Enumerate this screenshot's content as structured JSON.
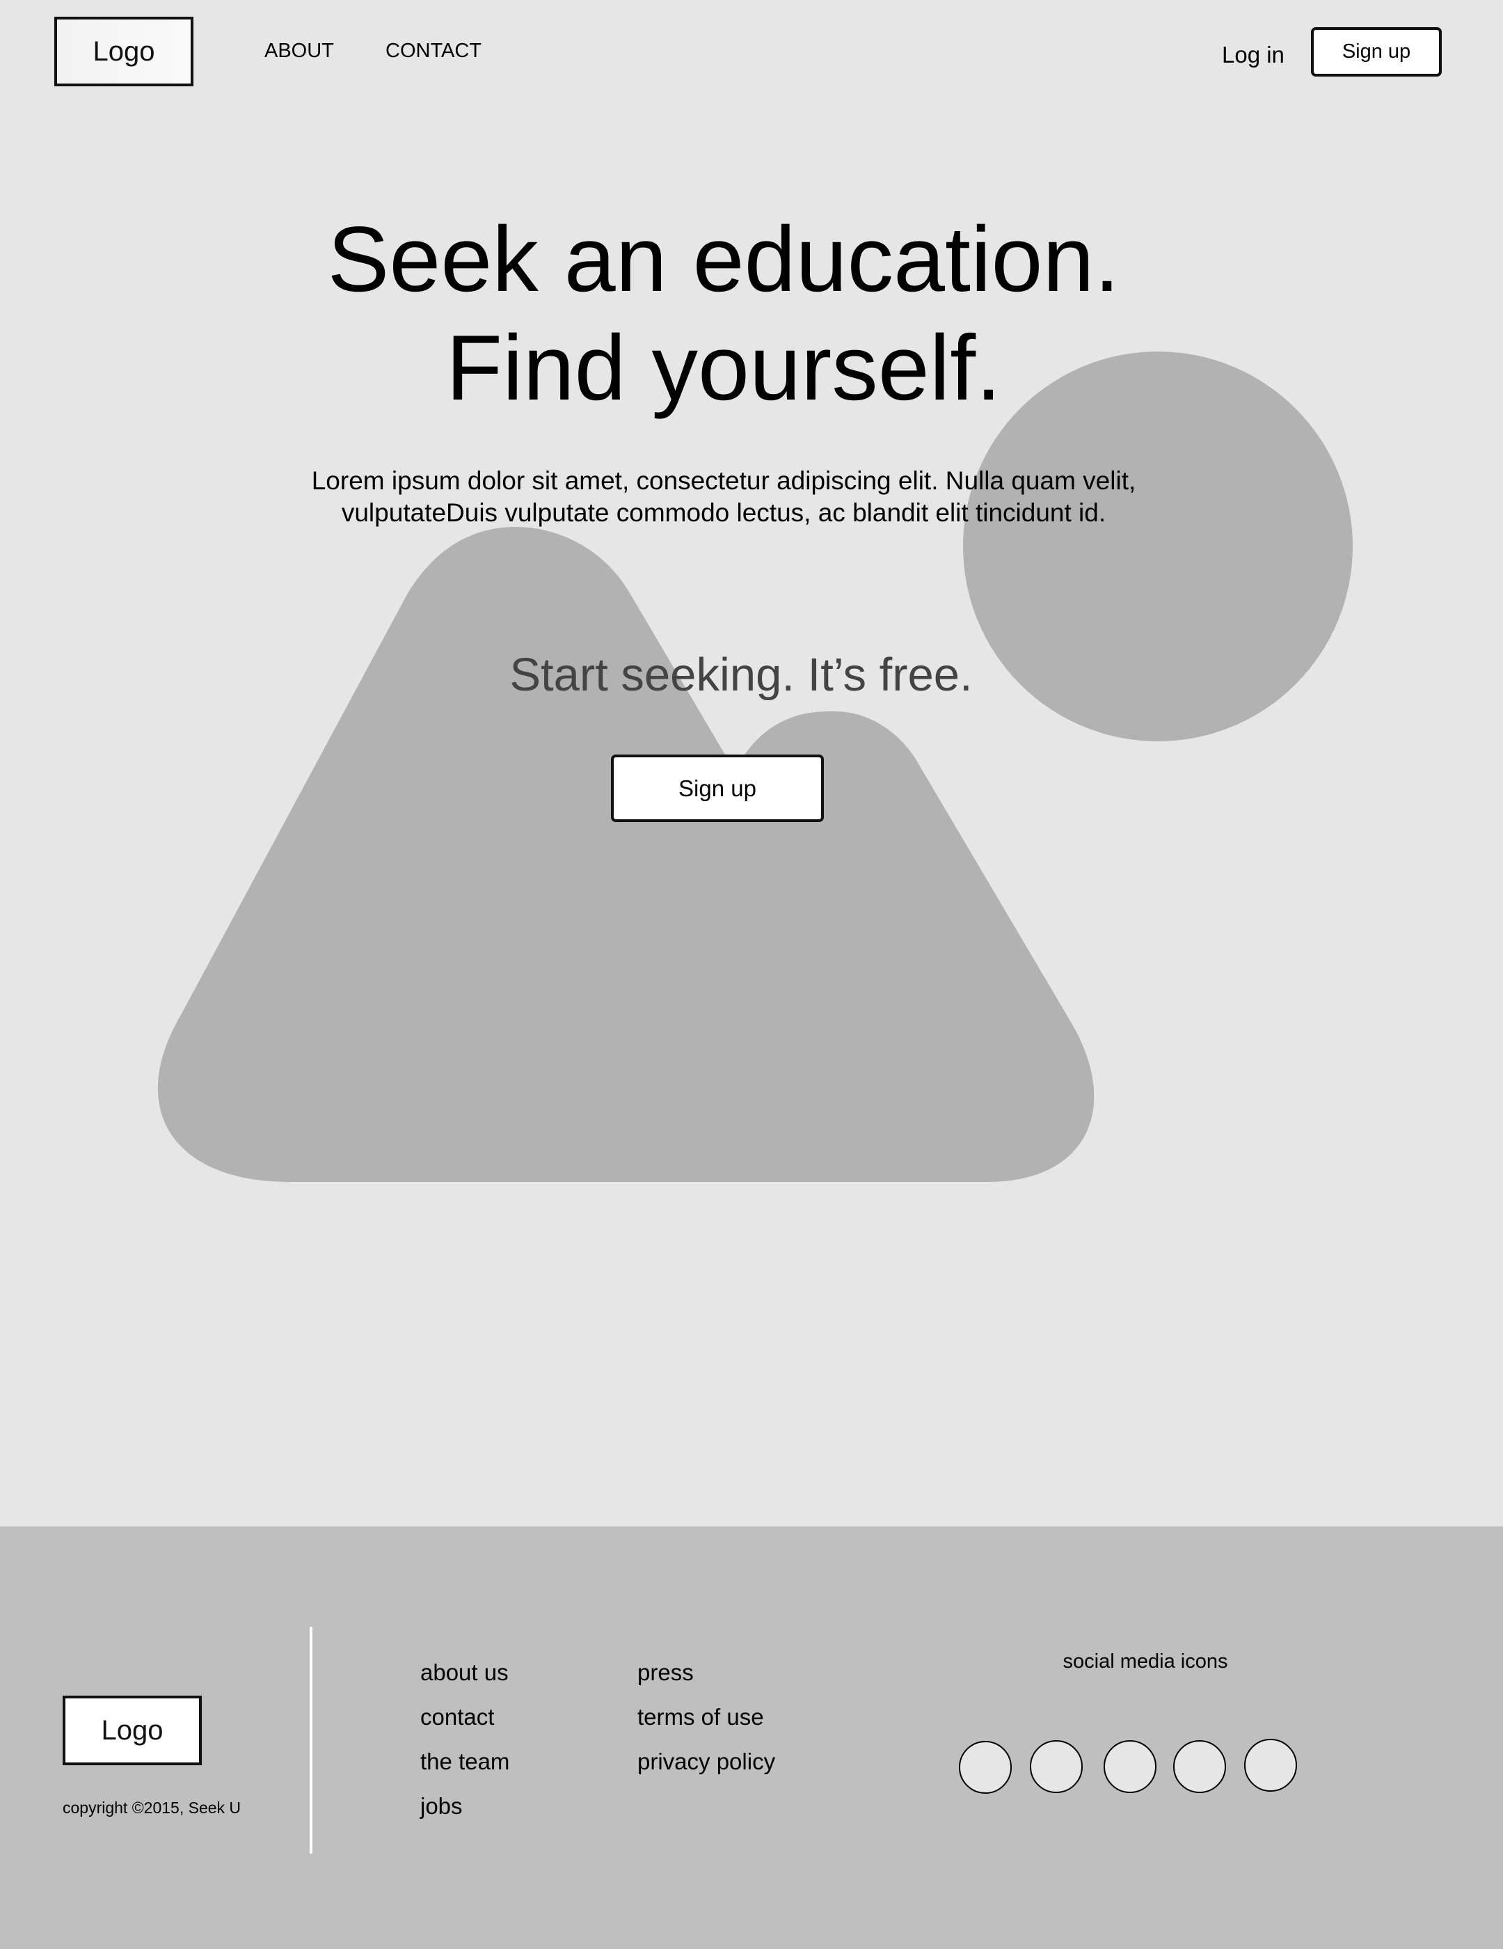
{
  "header": {
    "logo": "Logo",
    "nav": [
      {
        "label": "ABOUT"
      },
      {
        "label": "CONTACT"
      }
    ],
    "login_label": "Log in",
    "signup_label": "Sign up"
  },
  "hero": {
    "headline_line1": "Seek an education.",
    "headline_line2": "Find yourself.",
    "body_line1": "Lorem ipsum dolor sit amet, consectetur adipiscing elit. Nulla quam velit,",
    "body_line2": "vulputateDuis vulputate commodo lectus, ac blandit elit tincidunt id.",
    "cta_heading": "Start seeking. It’s free.",
    "cta_button": "Sign up"
  },
  "footer": {
    "logo": "Logo",
    "copyright": "copyright ©2015, Seek U",
    "links_col1": [
      "about us",
      "contact",
      "the team",
      "jobs"
    ],
    "links_col2": [
      "press",
      "terms of use",
      "privacy policy"
    ],
    "social_label": "social media icons",
    "social_icons": [
      "social-icon-1",
      "social-icon-2",
      "social-icon-3",
      "social-icon-4",
      "social-icon-5"
    ]
  },
  "colors": {
    "page_background": "#e6e6e6",
    "footer_background": "#bfbfbf",
    "placeholder_shape": "#b2b2b2",
    "cta_heading_text": "#444444",
    "button_background": "#ffffff",
    "button_border": "#111111"
  }
}
